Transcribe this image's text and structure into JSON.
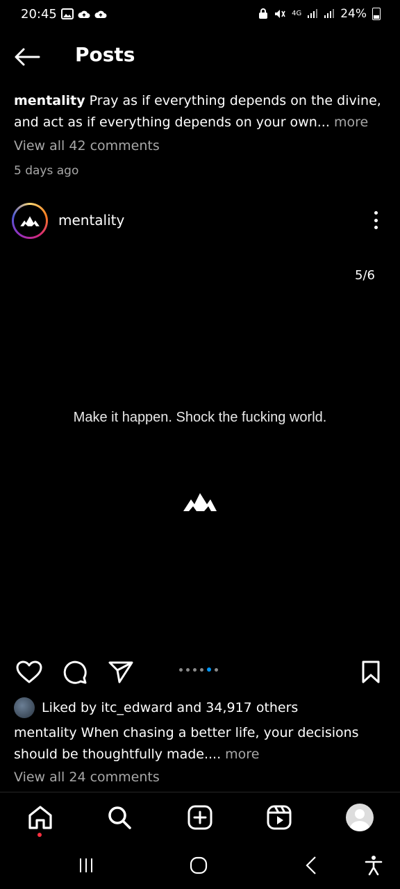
{
  "status_bar": {
    "time": "20:45",
    "network": "4G",
    "battery": "24%"
  },
  "header": {
    "title": "Posts"
  },
  "previous_post": {
    "username": "mentality",
    "caption": "Pray as if everything depends on the divine, and act as if everything depends on your own...",
    "more_label": "more",
    "view_all_comments": "View all 42 comments",
    "time_ago": "5 days ago"
  },
  "post": {
    "username": "mentality",
    "page_indicator": "5/6",
    "quote": "Make it happen. Shock the fucking world.",
    "carousel_count": 6,
    "carousel_active_index": 4,
    "liked_by": "Liked by itc_edward and 34,917 others",
    "caption_username": "mentality",
    "caption": "When chasing a better life, your decisions should be thoughtfully made....",
    "more_label": "more",
    "view_all_comments": "View all 24 comments"
  },
  "icons": {
    "back": "arrow-left-icon",
    "options": "more-vertical-icon",
    "like": "heart-icon",
    "comment": "comment-icon",
    "share": "send-icon",
    "save": "bookmark-icon",
    "home": "home-icon",
    "search": "search-icon",
    "create": "plus-square-icon",
    "reels": "reels-icon",
    "profile": "profile-avatar"
  },
  "colors": {
    "background": "#000000",
    "muted_text": "#a8a8a8",
    "carousel_active": "#0095f6",
    "notification": "#ff3040"
  }
}
